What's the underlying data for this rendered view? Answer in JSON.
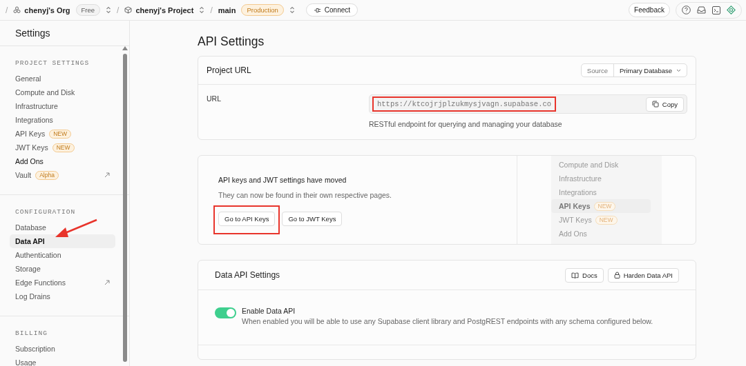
{
  "topbar": {
    "separators": [
      "/",
      "/",
      "/"
    ],
    "org": "chenyj's Org",
    "org_plan": "Free",
    "project": "chenyj's Project",
    "branch": "main",
    "branch_env": "Production",
    "connect": "Connect",
    "feedback": "Feedback"
  },
  "sidebar": {
    "title": "Settings",
    "pointer_arrow": true,
    "sections": [
      {
        "heading": "PROJECT SETTINGS",
        "items": [
          {
            "label": "General",
            "selected": false,
            "hovered": false,
            "external": false
          },
          {
            "label": "Compute and Disk",
            "selected": false,
            "hovered": false,
            "external": false
          },
          {
            "label": "Infrastructure",
            "selected": false,
            "hovered": false,
            "external": false
          },
          {
            "label": "Integrations",
            "selected": false,
            "hovered": false,
            "external": false
          },
          {
            "label": "API Keys",
            "badge": "NEW",
            "selected": false,
            "hovered": false,
            "external": false
          },
          {
            "label": "JWT Keys",
            "badge": "NEW",
            "selected": false,
            "hovered": false,
            "external": false
          },
          {
            "label": "Add Ons",
            "selected": false,
            "hovered": true,
            "external": false
          },
          {
            "label": "Vault",
            "badge": "Alpha",
            "external": true,
            "selected": false,
            "hovered": false
          }
        ]
      },
      {
        "heading": "CONFIGURATION",
        "items": [
          {
            "label": "Database",
            "selected": false,
            "hovered": false,
            "external": false
          },
          {
            "label": "Data API",
            "selected": true,
            "hovered": false,
            "external": false
          },
          {
            "label": "Authentication",
            "selected": false,
            "hovered": false,
            "external": false
          },
          {
            "label": "Storage",
            "selected": false,
            "hovered": false,
            "external": false
          },
          {
            "label": "Edge Functions",
            "external": true,
            "selected": false,
            "hovered": false
          },
          {
            "label": "Log Drains",
            "selected": false,
            "hovered": false,
            "external": false
          }
        ]
      },
      {
        "heading": "BILLING",
        "items": [
          {
            "label": "Subscription",
            "selected": false,
            "hovered": false,
            "external": false
          },
          {
            "label": "Usage",
            "selected": false,
            "hovered": false,
            "external": false
          }
        ]
      }
    ]
  },
  "page": {
    "title": "API Settings"
  },
  "project_url": {
    "title": "Project URL",
    "source_label": "Source",
    "source_value": "Primary Database",
    "field_label": "URL",
    "url": "https://ktcojrjplzukmysjvagn.supabase.co",
    "url_annotated": true,
    "copy": "Copy",
    "hint": "RESTful endpoint for querying and managing your database"
  },
  "moved_notice": {
    "title": "API keys and JWT settings have moved",
    "text": "They can now be found in their own respective pages.",
    "buttons": [
      {
        "label": "Go to API Keys",
        "annotated": true
      },
      {
        "label": "Go to JWT Keys",
        "annotated": false
      }
    ],
    "preview_items": [
      {
        "label": "Compute and Disk",
        "selected": false
      },
      {
        "label": "Infrastructure",
        "selected": false
      },
      {
        "label": "Integrations",
        "selected": false
      },
      {
        "label": "API Keys",
        "badge": "NEW",
        "selected": true
      },
      {
        "label": "JWT Keys",
        "badge": "NEW",
        "selected": false
      },
      {
        "label": "Add Ons",
        "selected": false
      }
    ]
  },
  "data_api": {
    "title": "Data API Settings",
    "docs": "Docs",
    "harden": "Harden Data API",
    "toggle_label": "Enable Data API",
    "toggle_on": true,
    "toggle_description": "When enabled you will be able to use any Supabase client library and PostgREST endpoints with any schema configured below."
  }
}
